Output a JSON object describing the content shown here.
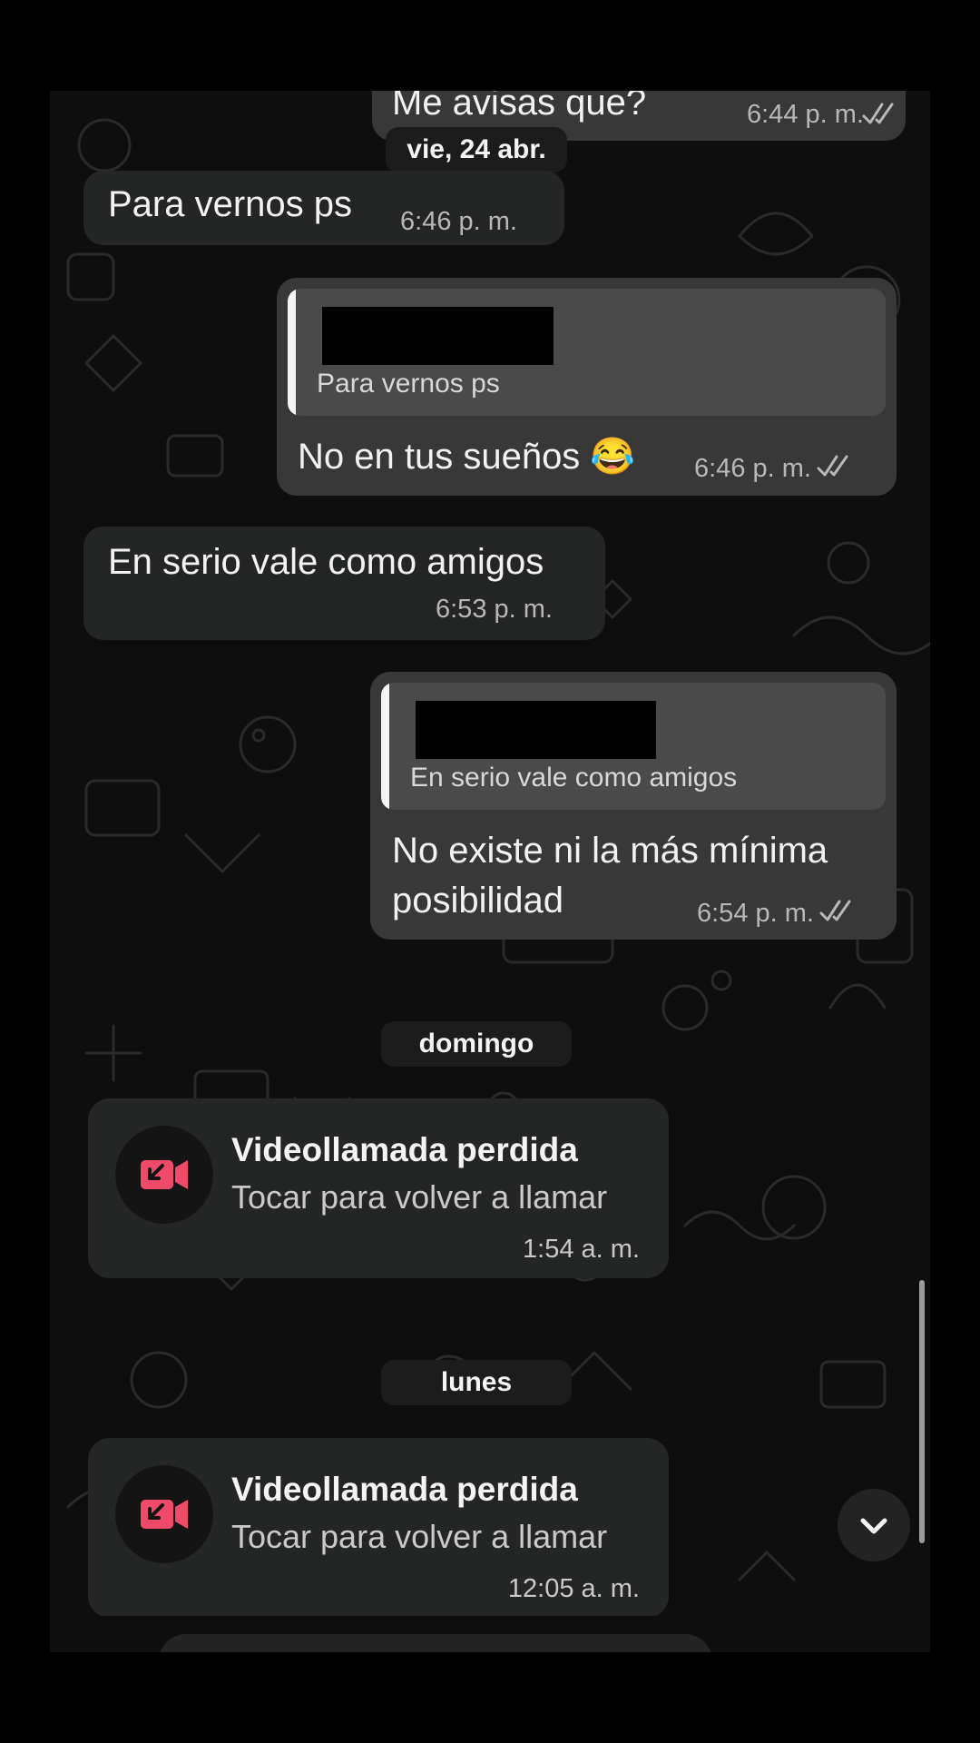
{
  "messages": [
    {
      "id": "m0",
      "direction": "out",
      "text": "Me avisas que?",
      "time": "6:44 p. m.",
      "status": "read"
    },
    {
      "id": "m1",
      "direction": "in",
      "text": "Para vernos ps",
      "time": "6:46 p. m."
    },
    {
      "id": "m2",
      "direction": "out",
      "reply_to": "Para vernos ps",
      "text": "No en tus sueños 😂",
      "time": "6:46 p. m.",
      "status": "read"
    },
    {
      "id": "m3",
      "direction": "in",
      "text": "En serio vale como amigos",
      "time": "6:53 p. m."
    },
    {
      "id": "m4",
      "direction": "out",
      "reply_to": "En serio vale como amigos",
      "text_line1": "No existe ni la más mínima",
      "text_line2": "posibilidad",
      "time": "6:54 p. m.",
      "status": "read"
    }
  ],
  "date_separators": {
    "d1": "vie, 24 abr.",
    "d2": "domingo",
    "d3": "lunes"
  },
  "calls": [
    {
      "title": "Videollamada perdida",
      "subtitle": "Tocar para volver a llamar",
      "time": "1:54 a. m.",
      "icon": "missed-video-call-icon"
    },
    {
      "title": "Videollamada perdida",
      "subtitle": "Tocar para volver a llamar",
      "time": "12:05 a. m.",
      "icon": "missed-video-call-icon"
    }
  ],
  "colors": {
    "incoming": "#242626",
    "outgoing": "#383838",
    "missed": "#ef4a6a",
    "background": "#0e0e0e"
  },
  "icons": {
    "read_receipt": "double-check-icon",
    "scroll": "chevron-down-icon"
  }
}
